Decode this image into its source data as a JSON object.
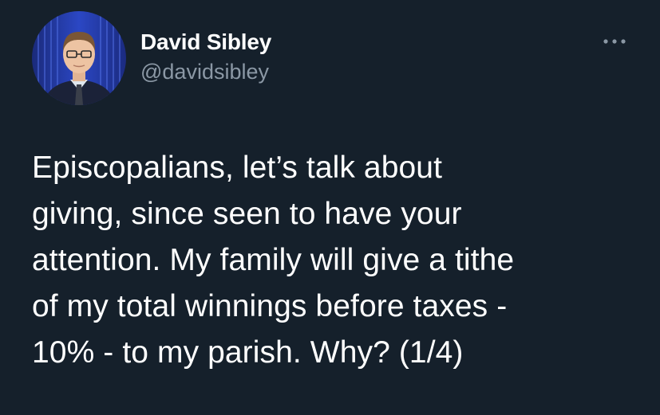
{
  "author": {
    "display_name": "David Sibley",
    "handle": "@davidsibley",
    "avatar_icon": "profile-photo"
  },
  "menu": {
    "icon": "more-horizontal-icon"
  },
  "tweet": {
    "text": "Episcopalians, let’s talk about\ngiving, since seen to have your\nattention. My family will give a tithe\nof my total winnings before taxes -\n10% - to my parish. Why? (1/4)"
  },
  "colors": {
    "background": "#15202b",
    "primary_text": "#ffffff",
    "secondary_text": "#8b98a5"
  }
}
